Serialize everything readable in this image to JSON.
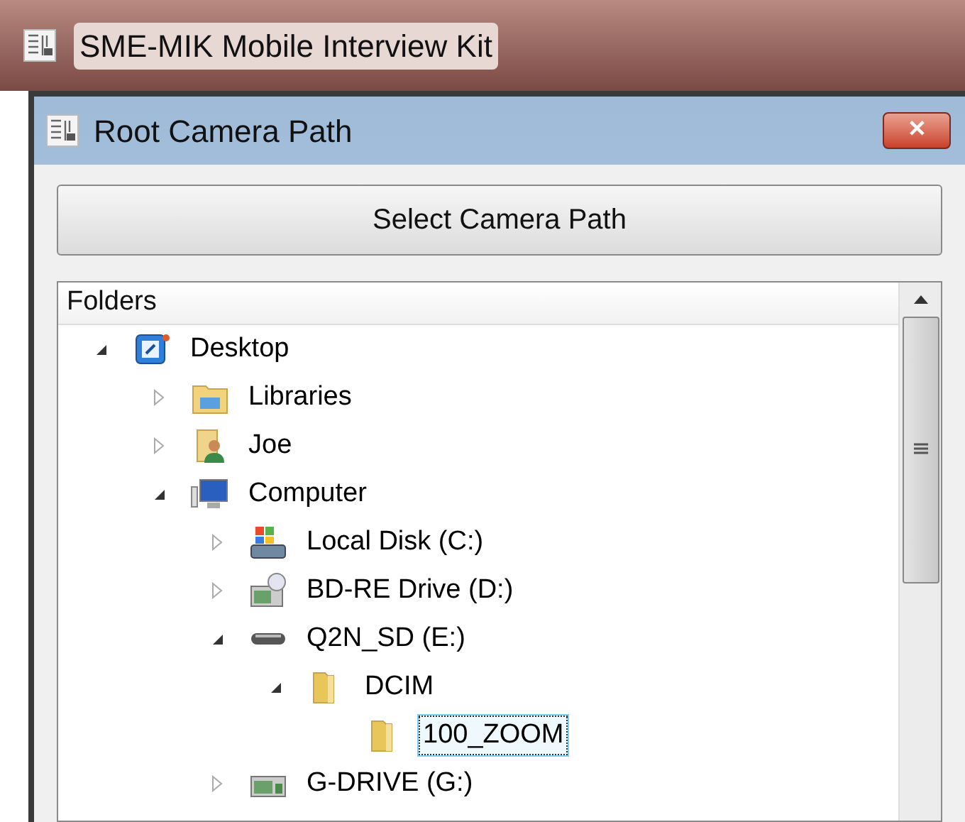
{
  "app_window": {
    "title": "SME-MIK Mobile Interview Kit"
  },
  "dialog": {
    "title": "Root Camera Path",
    "close_label": "✕"
  },
  "select_button": {
    "label": "Select Camera Path"
  },
  "tree": {
    "header": "Folders",
    "items": [
      {
        "label": "Desktop",
        "kind": "desktop",
        "expanded": true,
        "selected": false,
        "children": [
          {
            "label": "Libraries",
            "kind": "libraries",
            "expanded": false,
            "selected": false
          },
          {
            "label": "Joe",
            "kind": "user",
            "expanded": false,
            "selected": false
          },
          {
            "label": "Computer",
            "kind": "computer",
            "expanded": true,
            "selected": false,
            "children": [
              {
                "label": "Local Disk (C:)",
                "kind": "disk",
                "expanded": false,
                "selected": false
              },
              {
                "label": "BD-RE Drive (D:)",
                "kind": "optical",
                "expanded": false,
                "selected": false
              },
              {
                "label": "Q2N_SD (E:)",
                "kind": "removable",
                "expanded": true,
                "selected": false,
                "children": [
                  {
                    "label": "DCIM",
                    "kind": "folder",
                    "expanded": true,
                    "selected": false,
                    "children": [
                      {
                        "label": "100_ZOOM",
                        "kind": "folder",
                        "selected": true
                      }
                    ]
                  }
                ]
              },
              {
                "label": "G-DRIVE (G:)",
                "kind": "network",
                "expanded": false,
                "selected": false
              }
            ]
          }
        ]
      }
    ]
  }
}
